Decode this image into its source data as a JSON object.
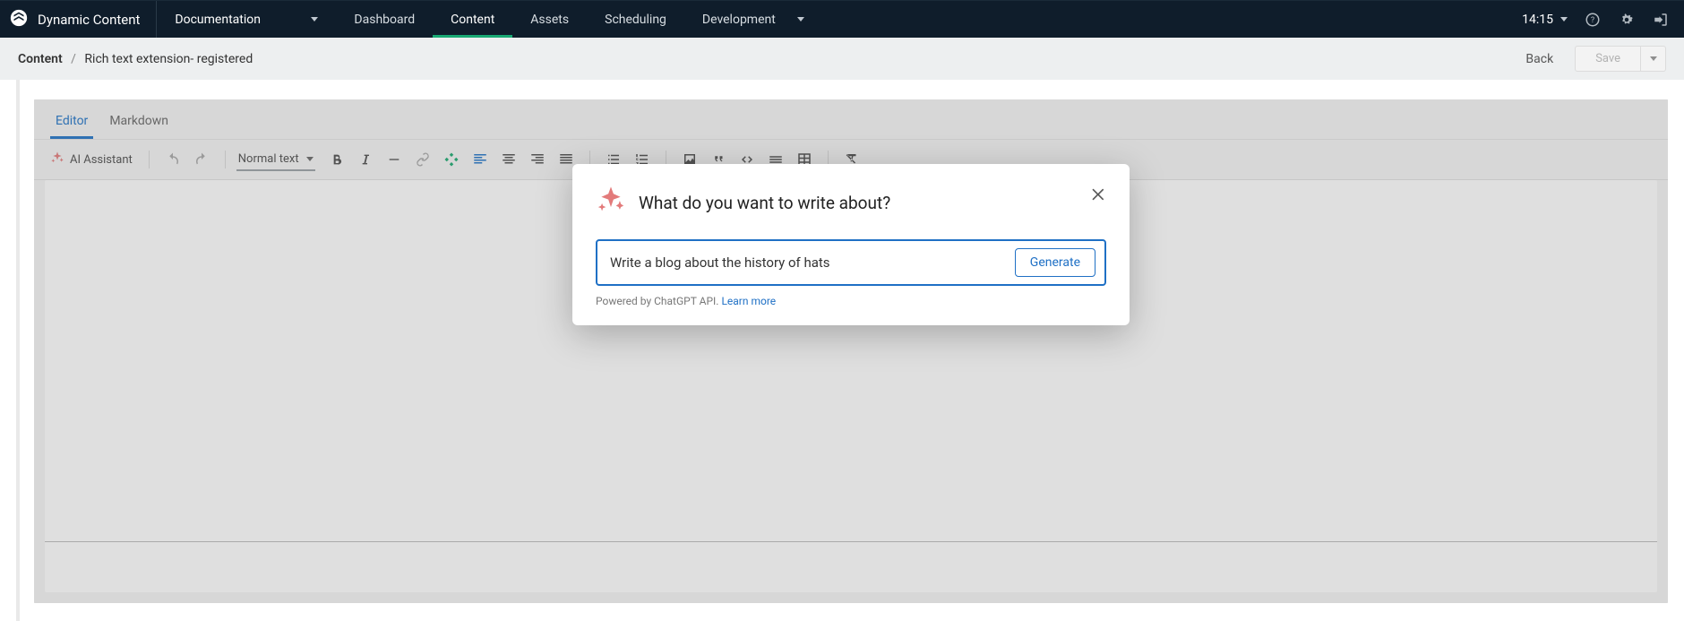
{
  "brand": "Dynamic Content",
  "hub": {
    "name": "Documentation"
  },
  "nav": {
    "dashboard": "Dashboard",
    "content": "Content",
    "assets": "Assets",
    "scheduling": "Scheduling",
    "development": "Development"
  },
  "clock": "14:15",
  "breadcrumb": {
    "root": "Content",
    "separator": "/",
    "current": "Rich text extension- registered"
  },
  "actions": {
    "back": "Back",
    "save": "Save"
  },
  "editor_tabs": {
    "editor": "Editor",
    "markdown": "Markdown"
  },
  "toolbar": {
    "ai_assistant": "AI Assistant",
    "format_select": "Normal text"
  },
  "modal": {
    "title": "What do you want to write about?",
    "input_value": "Write a blog about the history of hats",
    "generate": "Generate",
    "powered_prefix": "Powered by ChatGPT API. ",
    "learn_more": "Learn more"
  }
}
